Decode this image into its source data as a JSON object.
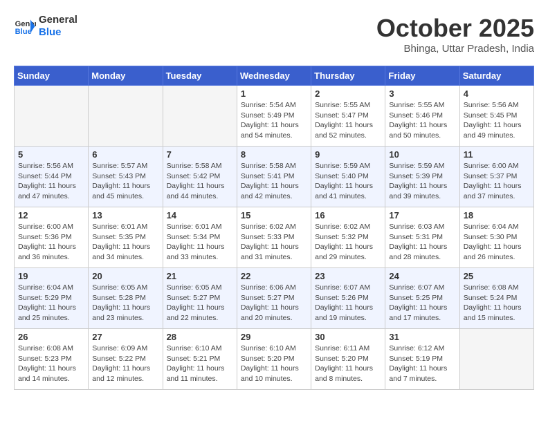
{
  "header": {
    "logo_line1": "General",
    "logo_line2": "Blue",
    "month": "October 2025",
    "location": "Bhinga, Uttar Pradesh, India"
  },
  "weekdays": [
    "Sunday",
    "Monday",
    "Tuesday",
    "Wednesday",
    "Thursday",
    "Friday",
    "Saturday"
  ],
  "weeks": [
    [
      {
        "day": "",
        "info": ""
      },
      {
        "day": "",
        "info": ""
      },
      {
        "day": "",
        "info": ""
      },
      {
        "day": "1",
        "info": "Sunrise: 5:54 AM\nSunset: 5:49 PM\nDaylight: 11 hours\nand 54 minutes."
      },
      {
        "day": "2",
        "info": "Sunrise: 5:55 AM\nSunset: 5:47 PM\nDaylight: 11 hours\nand 52 minutes."
      },
      {
        "day": "3",
        "info": "Sunrise: 5:55 AM\nSunset: 5:46 PM\nDaylight: 11 hours\nand 50 minutes."
      },
      {
        "day": "4",
        "info": "Sunrise: 5:56 AM\nSunset: 5:45 PM\nDaylight: 11 hours\nand 49 minutes."
      }
    ],
    [
      {
        "day": "5",
        "info": "Sunrise: 5:56 AM\nSunset: 5:44 PM\nDaylight: 11 hours\nand 47 minutes."
      },
      {
        "day": "6",
        "info": "Sunrise: 5:57 AM\nSunset: 5:43 PM\nDaylight: 11 hours\nand 45 minutes."
      },
      {
        "day": "7",
        "info": "Sunrise: 5:58 AM\nSunset: 5:42 PM\nDaylight: 11 hours\nand 44 minutes."
      },
      {
        "day": "8",
        "info": "Sunrise: 5:58 AM\nSunset: 5:41 PM\nDaylight: 11 hours\nand 42 minutes."
      },
      {
        "day": "9",
        "info": "Sunrise: 5:59 AM\nSunset: 5:40 PM\nDaylight: 11 hours\nand 41 minutes."
      },
      {
        "day": "10",
        "info": "Sunrise: 5:59 AM\nSunset: 5:39 PM\nDaylight: 11 hours\nand 39 minutes."
      },
      {
        "day": "11",
        "info": "Sunrise: 6:00 AM\nSunset: 5:37 PM\nDaylight: 11 hours\nand 37 minutes."
      }
    ],
    [
      {
        "day": "12",
        "info": "Sunrise: 6:00 AM\nSunset: 5:36 PM\nDaylight: 11 hours\nand 36 minutes."
      },
      {
        "day": "13",
        "info": "Sunrise: 6:01 AM\nSunset: 5:35 PM\nDaylight: 11 hours\nand 34 minutes."
      },
      {
        "day": "14",
        "info": "Sunrise: 6:01 AM\nSunset: 5:34 PM\nDaylight: 11 hours\nand 33 minutes."
      },
      {
        "day": "15",
        "info": "Sunrise: 6:02 AM\nSunset: 5:33 PM\nDaylight: 11 hours\nand 31 minutes."
      },
      {
        "day": "16",
        "info": "Sunrise: 6:02 AM\nSunset: 5:32 PM\nDaylight: 11 hours\nand 29 minutes."
      },
      {
        "day": "17",
        "info": "Sunrise: 6:03 AM\nSunset: 5:31 PM\nDaylight: 11 hours\nand 28 minutes."
      },
      {
        "day": "18",
        "info": "Sunrise: 6:04 AM\nSunset: 5:30 PM\nDaylight: 11 hours\nand 26 minutes."
      }
    ],
    [
      {
        "day": "19",
        "info": "Sunrise: 6:04 AM\nSunset: 5:29 PM\nDaylight: 11 hours\nand 25 minutes."
      },
      {
        "day": "20",
        "info": "Sunrise: 6:05 AM\nSunset: 5:28 PM\nDaylight: 11 hours\nand 23 minutes."
      },
      {
        "day": "21",
        "info": "Sunrise: 6:05 AM\nSunset: 5:27 PM\nDaylight: 11 hours\nand 22 minutes."
      },
      {
        "day": "22",
        "info": "Sunrise: 6:06 AM\nSunset: 5:27 PM\nDaylight: 11 hours\nand 20 minutes."
      },
      {
        "day": "23",
        "info": "Sunrise: 6:07 AM\nSunset: 5:26 PM\nDaylight: 11 hours\nand 19 minutes."
      },
      {
        "day": "24",
        "info": "Sunrise: 6:07 AM\nSunset: 5:25 PM\nDaylight: 11 hours\nand 17 minutes."
      },
      {
        "day": "25",
        "info": "Sunrise: 6:08 AM\nSunset: 5:24 PM\nDaylight: 11 hours\nand 15 minutes."
      }
    ],
    [
      {
        "day": "26",
        "info": "Sunrise: 6:08 AM\nSunset: 5:23 PM\nDaylight: 11 hours\nand 14 minutes."
      },
      {
        "day": "27",
        "info": "Sunrise: 6:09 AM\nSunset: 5:22 PM\nDaylight: 11 hours\nand 12 minutes."
      },
      {
        "day": "28",
        "info": "Sunrise: 6:10 AM\nSunset: 5:21 PM\nDaylight: 11 hours\nand 11 minutes."
      },
      {
        "day": "29",
        "info": "Sunrise: 6:10 AM\nSunset: 5:20 PM\nDaylight: 11 hours\nand 10 minutes."
      },
      {
        "day": "30",
        "info": "Sunrise: 6:11 AM\nSunset: 5:20 PM\nDaylight: 11 hours\nand 8 minutes."
      },
      {
        "day": "31",
        "info": "Sunrise: 6:12 AM\nSunset: 5:19 PM\nDaylight: 11 hours\nand 7 minutes."
      },
      {
        "day": "",
        "info": ""
      }
    ]
  ]
}
